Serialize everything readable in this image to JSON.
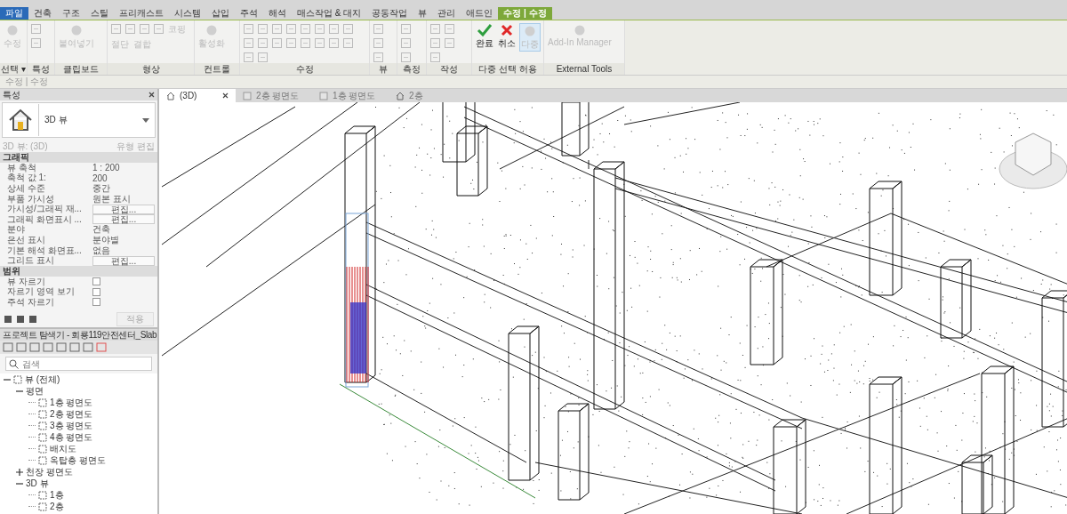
{
  "ribbon_tabs": [
    {
      "label": "파일",
      "kind": "file",
      "selected": false
    },
    {
      "label": "건축",
      "kind": "tab",
      "selected": false
    },
    {
      "label": "구조",
      "kind": "tab",
      "selected": false
    },
    {
      "label": "스틸",
      "kind": "tab",
      "selected": false
    },
    {
      "label": "프리캐스트",
      "kind": "tab",
      "selected": false
    },
    {
      "label": "시스템",
      "kind": "tab",
      "selected": false
    },
    {
      "label": "삽입",
      "kind": "tab",
      "selected": false
    },
    {
      "label": "주석",
      "kind": "tab",
      "selected": false
    },
    {
      "label": "해석",
      "kind": "tab",
      "selected": false
    },
    {
      "label": "매스작업 & 대지",
      "kind": "tab",
      "selected": false
    },
    {
      "label": "공동작업",
      "kind": "tab",
      "selected": false
    },
    {
      "label": "뷰",
      "kind": "tab",
      "selected": false
    },
    {
      "label": "관리",
      "kind": "tab",
      "selected": false
    },
    {
      "label": "애드인",
      "kind": "tab",
      "selected": false
    },
    {
      "label": "수정 | 수정",
      "kind": "context",
      "selected": true
    }
  ],
  "ribbon_panels": [
    {
      "title": "선택 ▾",
      "tools": [
        {
          "label": "수정",
          "kind": "cursor",
          "disabled": true
        }
      ]
    },
    {
      "title": "특성"
    },
    {
      "title": "클립보드",
      "tools": [
        {
          "label": "붙여넣기",
          "kind": "paste",
          "disabled": true
        }
      ]
    },
    {
      "title": "형상",
      "tools": [
        {
          "label": "코핑",
          "kind": "small",
          "disabled": true
        },
        {
          "label": "절단",
          "kind": "small",
          "disabled": true
        },
        {
          "label": "결합",
          "kind": "small",
          "disabled": true
        }
      ]
    },
    {
      "title": "컨트롤",
      "tools": [
        {
          "label": "활성화",
          "kind": "pin",
          "disabled": true
        }
      ]
    },
    {
      "title": "수정"
    },
    {
      "title": "뷰"
    },
    {
      "title": "측정"
    },
    {
      "title": "작성"
    },
    {
      "title": "다중 선택 허용",
      "tools": [
        {
          "label": "완료",
          "kind": "finish",
          "disabled": false
        },
        {
          "label": "취소",
          "kind": "cancel",
          "disabled": false
        },
        {
          "label": "다중",
          "kind": "multi",
          "disabled": true
        }
      ]
    },
    {
      "title": "External Tools",
      "tools": [
        {
          "label": "Add-In Manager",
          "kind": "addin",
          "disabled": true
        }
      ]
    }
  ],
  "options_bar": {
    "label": "수정 | 수정"
  },
  "properties": {
    "title": "특성",
    "type_name": "3D 뷰",
    "instance": "3D 뷰: (3D)",
    "edit_type": "유형 편집",
    "sections": [
      {
        "title": "그래픽",
        "rows": [
          {
            "label": "뷰 축척",
            "value": "1 : 200",
            "kind": "text"
          },
          {
            "label": "축척 값    1:",
            "value": "200",
            "kind": "text"
          },
          {
            "label": "상세 수준",
            "value": "중간",
            "kind": "text"
          },
          {
            "label": "부품 가시성",
            "value": "원본 표시",
            "kind": "text"
          },
          {
            "label": "가시성/그래픽 재...",
            "value": "편집...",
            "kind": "button"
          },
          {
            "label": "그래픽 화면표시 ...",
            "value": "편집...",
            "kind": "button"
          },
          {
            "label": "분야",
            "value": "건축",
            "kind": "text"
          },
          {
            "label": "은선 표시",
            "value": "분야별",
            "kind": "text"
          },
          {
            "label": "기본 해석 화면표...",
            "value": "없음",
            "kind": "text"
          },
          {
            "label": "그리드 표시",
            "value": "편집...",
            "kind": "button"
          }
        ]
      },
      {
        "title": "범위",
        "rows": [
          {
            "label": "뷰 자르기",
            "kind": "checkbox",
            "checked": false
          },
          {
            "label": "자르기 영역 보기",
            "kind": "checkbox",
            "checked": false
          },
          {
            "label": "주석 자르기",
            "kind": "checkbox",
            "checked": false
          }
        ]
      }
    ],
    "apply": "적용"
  },
  "browser": {
    "title": "프로젝트 탐색기 - 회룡119안전센터_Slab",
    "search": {
      "placeholder": "검색"
    },
    "tree": [
      {
        "label": "뷰 (전체)",
        "kind": "root",
        "expanded": true,
        "children": [
          {
            "label": "평면",
            "kind": "group",
            "expanded": true,
            "children": [
              {
                "label": "1층 평면도",
                "kind": "view"
              },
              {
                "label": "2층 평면도",
                "kind": "view"
              },
              {
                "label": "3층 평면도",
                "kind": "view"
              },
              {
                "label": "4층 평면도",
                "kind": "view"
              },
              {
                "label": "배치도",
                "kind": "view"
              },
              {
                "label": "옥탑층 평면도",
                "kind": "view"
              }
            ]
          },
          {
            "label": "천장 평면도",
            "kind": "group",
            "expanded": false
          },
          {
            "label": "3D 뷰",
            "kind": "group",
            "expanded": true,
            "children": [
              {
                "label": "1층",
                "kind": "view"
              },
              {
                "label": "2층",
                "kind": "view"
              }
            ]
          }
        ]
      }
    ]
  },
  "view_tabs": [
    {
      "label": "(3D)",
      "kind": "model",
      "selected": true
    },
    {
      "label": "2층 평면도",
      "kind": "plan",
      "selected": false
    },
    {
      "label": "1층 평면도",
      "kind": "plan",
      "selected": false
    },
    {
      "label": "2층",
      "kind": "model",
      "selected": false
    }
  ]
}
